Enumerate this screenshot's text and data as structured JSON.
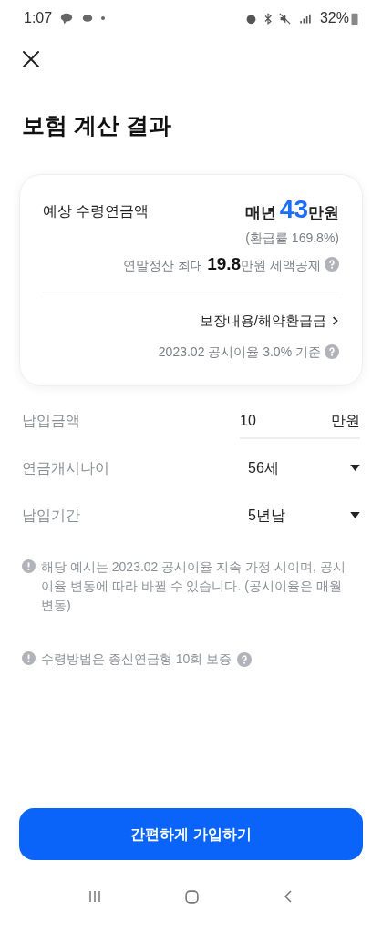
{
  "status_bar": {
    "time": "1:07",
    "battery": "32%"
  },
  "title": "보험 계산 결과",
  "summary": {
    "label": "예상 수령연금액",
    "amount_prefix": "매년",
    "amount_value": "43",
    "amount_suffix": "만원",
    "refund_rate": "(환급률 169.8%)",
    "tax_note": "연말정산 최대 **19.8**만원 세액공제",
    "link": "보장내용/해약환급금",
    "rate_note": "2023.02 공시이율 3.0% 기준"
  },
  "fields": [
    {
      "kind": "input",
      "label": "납입금액",
      "value": "10",
      "unit": "만원"
    },
    {
      "kind": "select",
      "label": "연금개시나이",
      "value": "56세"
    },
    {
      "kind": "select",
      "label": "납입기간",
      "value": "5년납"
    }
  ],
  "notes": [
    {
      "text": "해당 예시는 2023.02 공시이율 지속 가정 시이며, 공시이율 변동에 따라 바뀔 수 있습니다. (공시이율은 매월 변동)",
      "help": false
    },
    {
      "text": "수령방법은 종신연금형 10회 보증",
      "help": true
    }
  ],
  "cta": "간편하게 가입하기"
}
